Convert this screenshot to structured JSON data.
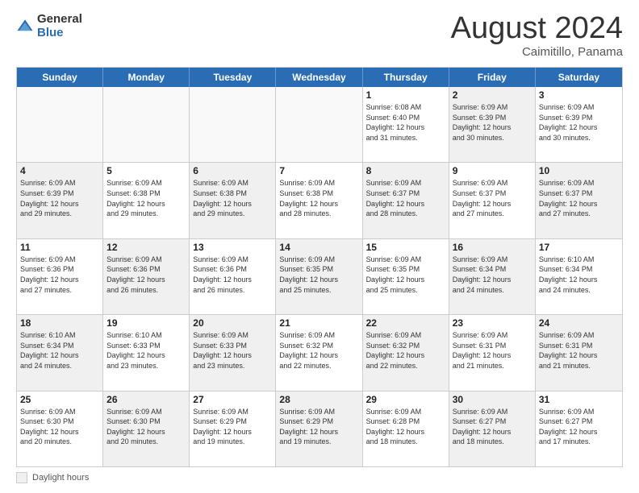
{
  "logo": {
    "general": "General",
    "blue": "Blue"
  },
  "title": "August 2024",
  "subtitle": "Caimitillo, Panama",
  "days_of_week": [
    "Sunday",
    "Monday",
    "Tuesday",
    "Wednesday",
    "Thursday",
    "Friday",
    "Saturday"
  ],
  "legend_label": "Daylight hours",
  "weeks": [
    [
      {
        "day": "",
        "info": "",
        "empty": true
      },
      {
        "day": "",
        "info": "",
        "empty": true
      },
      {
        "day": "",
        "info": "",
        "empty": true
      },
      {
        "day": "",
        "info": "",
        "empty": true
      },
      {
        "day": "1",
        "info": "Sunrise: 6:08 AM\nSunset: 6:40 PM\nDaylight: 12 hours\nand 31 minutes.",
        "empty": false
      },
      {
        "day": "2",
        "info": "Sunrise: 6:09 AM\nSunset: 6:39 PM\nDaylight: 12 hours\nand 30 minutes.",
        "empty": false,
        "shaded": true
      },
      {
        "day": "3",
        "info": "Sunrise: 6:09 AM\nSunset: 6:39 PM\nDaylight: 12 hours\nand 30 minutes.",
        "empty": false
      }
    ],
    [
      {
        "day": "4",
        "info": "Sunrise: 6:09 AM\nSunset: 6:39 PM\nDaylight: 12 hours\nand 29 minutes.",
        "empty": false,
        "shaded": true
      },
      {
        "day": "5",
        "info": "Sunrise: 6:09 AM\nSunset: 6:38 PM\nDaylight: 12 hours\nand 29 minutes.",
        "empty": false
      },
      {
        "day": "6",
        "info": "Sunrise: 6:09 AM\nSunset: 6:38 PM\nDaylight: 12 hours\nand 29 minutes.",
        "empty": false,
        "shaded": true
      },
      {
        "day": "7",
        "info": "Sunrise: 6:09 AM\nSunset: 6:38 PM\nDaylight: 12 hours\nand 28 minutes.",
        "empty": false
      },
      {
        "day": "8",
        "info": "Sunrise: 6:09 AM\nSunset: 6:37 PM\nDaylight: 12 hours\nand 28 minutes.",
        "empty": false,
        "shaded": true
      },
      {
        "day": "9",
        "info": "Sunrise: 6:09 AM\nSunset: 6:37 PM\nDaylight: 12 hours\nand 27 minutes.",
        "empty": false
      },
      {
        "day": "10",
        "info": "Sunrise: 6:09 AM\nSunset: 6:37 PM\nDaylight: 12 hours\nand 27 minutes.",
        "empty": false,
        "shaded": true
      }
    ],
    [
      {
        "day": "11",
        "info": "Sunrise: 6:09 AM\nSunset: 6:36 PM\nDaylight: 12 hours\nand 27 minutes.",
        "empty": false
      },
      {
        "day": "12",
        "info": "Sunrise: 6:09 AM\nSunset: 6:36 PM\nDaylight: 12 hours\nand 26 minutes.",
        "empty": false,
        "shaded": true
      },
      {
        "day": "13",
        "info": "Sunrise: 6:09 AM\nSunset: 6:36 PM\nDaylight: 12 hours\nand 26 minutes.",
        "empty": false
      },
      {
        "day": "14",
        "info": "Sunrise: 6:09 AM\nSunset: 6:35 PM\nDaylight: 12 hours\nand 25 minutes.",
        "empty": false,
        "shaded": true
      },
      {
        "day": "15",
        "info": "Sunrise: 6:09 AM\nSunset: 6:35 PM\nDaylight: 12 hours\nand 25 minutes.",
        "empty": false
      },
      {
        "day": "16",
        "info": "Sunrise: 6:09 AM\nSunset: 6:34 PM\nDaylight: 12 hours\nand 24 minutes.",
        "empty": false,
        "shaded": true
      },
      {
        "day": "17",
        "info": "Sunrise: 6:10 AM\nSunset: 6:34 PM\nDaylight: 12 hours\nand 24 minutes.",
        "empty": false
      }
    ],
    [
      {
        "day": "18",
        "info": "Sunrise: 6:10 AM\nSunset: 6:34 PM\nDaylight: 12 hours\nand 24 minutes.",
        "empty": false,
        "shaded": true
      },
      {
        "day": "19",
        "info": "Sunrise: 6:10 AM\nSunset: 6:33 PM\nDaylight: 12 hours\nand 23 minutes.",
        "empty": false
      },
      {
        "day": "20",
        "info": "Sunrise: 6:09 AM\nSunset: 6:33 PM\nDaylight: 12 hours\nand 23 minutes.",
        "empty": false,
        "shaded": true
      },
      {
        "day": "21",
        "info": "Sunrise: 6:09 AM\nSunset: 6:32 PM\nDaylight: 12 hours\nand 22 minutes.",
        "empty": false
      },
      {
        "day": "22",
        "info": "Sunrise: 6:09 AM\nSunset: 6:32 PM\nDaylight: 12 hours\nand 22 minutes.",
        "empty": false,
        "shaded": true
      },
      {
        "day": "23",
        "info": "Sunrise: 6:09 AM\nSunset: 6:31 PM\nDaylight: 12 hours\nand 21 minutes.",
        "empty": false
      },
      {
        "day": "24",
        "info": "Sunrise: 6:09 AM\nSunset: 6:31 PM\nDaylight: 12 hours\nand 21 minutes.",
        "empty": false,
        "shaded": true
      }
    ],
    [
      {
        "day": "25",
        "info": "Sunrise: 6:09 AM\nSunset: 6:30 PM\nDaylight: 12 hours\nand 20 minutes.",
        "empty": false
      },
      {
        "day": "26",
        "info": "Sunrise: 6:09 AM\nSunset: 6:30 PM\nDaylight: 12 hours\nand 20 minutes.",
        "empty": false,
        "shaded": true
      },
      {
        "day": "27",
        "info": "Sunrise: 6:09 AM\nSunset: 6:29 PM\nDaylight: 12 hours\nand 19 minutes.",
        "empty": false
      },
      {
        "day": "28",
        "info": "Sunrise: 6:09 AM\nSunset: 6:29 PM\nDaylight: 12 hours\nand 19 minutes.",
        "empty": false,
        "shaded": true
      },
      {
        "day": "29",
        "info": "Sunrise: 6:09 AM\nSunset: 6:28 PM\nDaylight: 12 hours\nand 18 minutes.",
        "empty": false
      },
      {
        "day": "30",
        "info": "Sunrise: 6:09 AM\nSunset: 6:27 PM\nDaylight: 12 hours\nand 18 minutes.",
        "empty": false,
        "shaded": true
      },
      {
        "day": "31",
        "info": "Sunrise: 6:09 AM\nSunset: 6:27 PM\nDaylight: 12 hours\nand 17 minutes.",
        "empty": false
      }
    ]
  ]
}
